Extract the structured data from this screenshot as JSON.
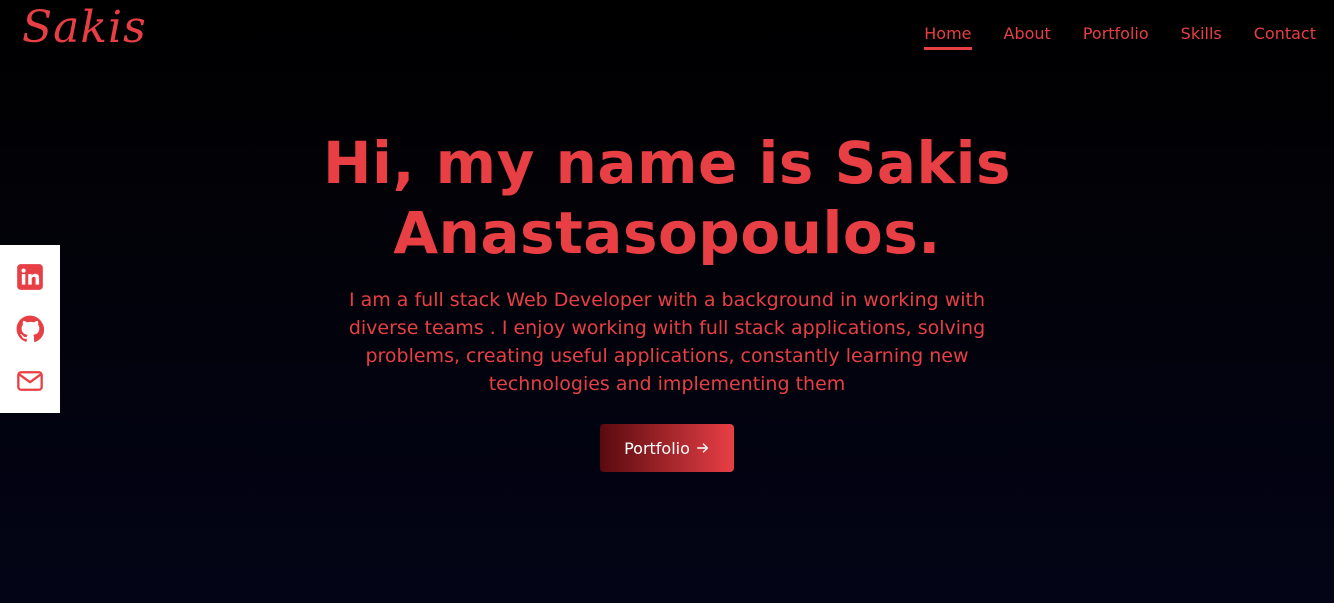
{
  "header": {
    "logo": "Sakis",
    "nav": [
      {
        "label": "Home",
        "active": true
      },
      {
        "label": "About",
        "active": false
      },
      {
        "label": "Portfolio",
        "active": false
      },
      {
        "label": "Skills",
        "active": false
      },
      {
        "label": "Contact",
        "active": false
      }
    ]
  },
  "hero": {
    "title": "Hi, my name is Sakis Anastasopoulos.",
    "description": "I am a full stack Web Developer with a background in working with diverse teams . I enjoy working with full stack applications, solving problems, creating useful applications, constantly learning new technologies and implementing them",
    "cta_label": "Portfolio"
  },
  "social": [
    {
      "icon": "linkedin-icon"
    },
    {
      "icon": "github-icon"
    },
    {
      "icon": "mail-icon"
    }
  ],
  "colors": {
    "accent": "#e83f45",
    "background": "#000000",
    "sidebar": "#ffffff"
  }
}
